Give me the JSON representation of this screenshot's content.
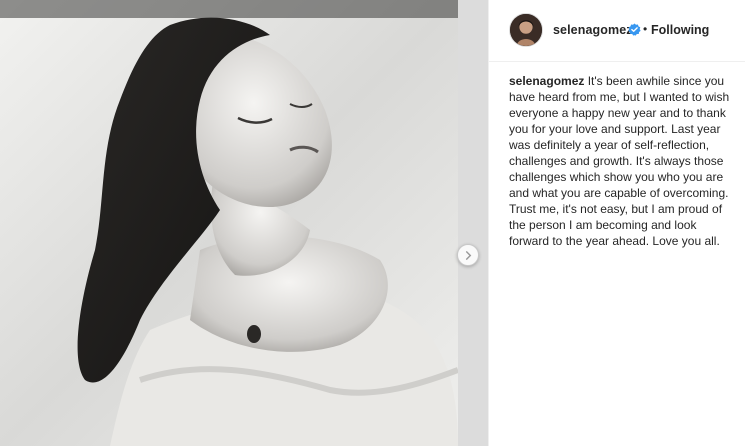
{
  "post": {
    "username": "selenagomez",
    "separator": "•",
    "follow_status": "Following",
    "caption_user": "selenagomez",
    "caption_text": " It's been awhile since you\nhave heard from me, but I wanted to wish\neveryone a happy new year and to thank\nyou for your love and support. Last year\nwas definitely a year of self-reflection,\nchallenges and growth. It's always those\nchallenges which show you who you are\nand what you are capable of overcoming.\nTrust me, it's not easy, but I am proud of\nthe person I am becoming and look\nforward to the year ahead. Love you all."
  },
  "icons": {
    "verified": "verified-badge-icon",
    "next": "chevron-right-icon"
  },
  "colors": {
    "verified": "#3897f0",
    "text": "#262626",
    "border": "#efefef"
  }
}
